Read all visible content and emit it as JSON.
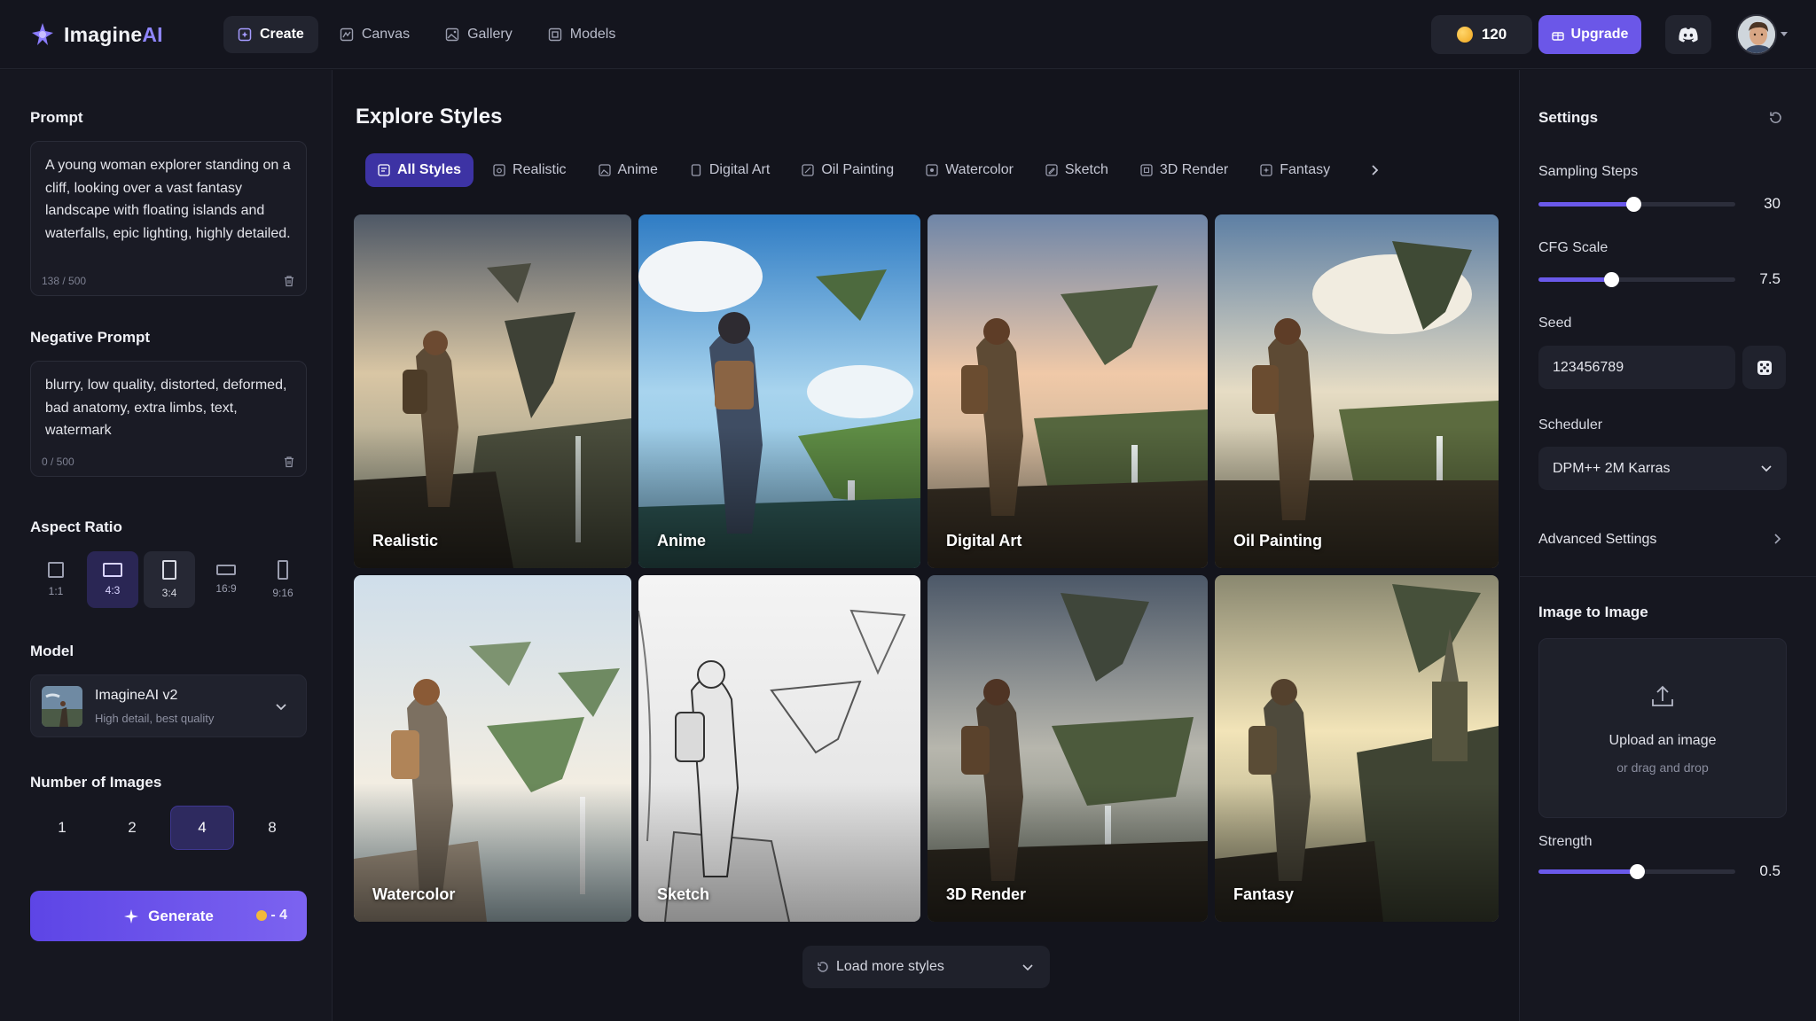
{
  "app": {
    "name_main": "Imagine",
    "name_accent": "AI",
    "brand_color": "#6b57e8"
  },
  "nav": {
    "items": [
      {
        "label": "Create",
        "icon": "sparkle-square-icon"
      },
      {
        "label": "Canvas",
        "icon": "canvas-icon"
      },
      {
        "label": "Gallery",
        "icon": "image-icon"
      },
      {
        "label": "Models",
        "icon": "cube-icon"
      }
    ]
  },
  "header": {
    "credits": "120",
    "upgrade_label": "Upgrade"
  },
  "left": {
    "prompt_label": "Prompt",
    "prompt_text": "A young woman explorer standing on a cliff, looking over a vast fantasy landscape with floating islands and waterfalls, epic lighting, highly detailed.",
    "prompt_counter": "138 / 500",
    "negative_label": "Negative Prompt",
    "negative_text": "blurry, low quality, distorted, deformed, bad anatomy, extra limbs, text, watermark",
    "negative_counter": "0 / 500",
    "aspect_label": "Aspect Ratio",
    "aspects": [
      "1:1",
      "4:3",
      "3:4",
      "16:9",
      "9:16"
    ],
    "model_label": "Model",
    "model_name": "ImagineAI v2",
    "model_sub": "High detail, best quality",
    "num_label": "Number of Images",
    "nums": [
      "1",
      "2",
      "4",
      "8"
    ],
    "generate_label": "Generate",
    "generate_cost": "- 4"
  },
  "main": {
    "title": "Explore Styles",
    "tabs": [
      "All Styles",
      "Realistic",
      "Anime",
      "Digital Art",
      "Oil Painting",
      "Watercolor",
      "Sketch",
      "3D Render",
      "Fantasy"
    ],
    "cards": [
      "Realistic",
      "Anime",
      "Digital Art",
      "Oil Painting",
      "Watercolor",
      "Sketch",
      "3D Render",
      "Fantasy"
    ],
    "load_more": "Load more styles"
  },
  "right": {
    "settings_title": "Settings",
    "sampling_label": "Sampling Steps",
    "sampling_value": "30",
    "sampling_fraction": 0.48,
    "cfg_label": "CFG Scale",
    "cfg_value": "7.5",
    "cfg_fraction": 0.37,
    "seed_label": "Seed",
    "seed_value": "123456789",
    "scheduler_label": "Scheduler",
    "scheduler_value": "DPM++ 2M Karras",
    "advanced_label": "Advanced Settings",
    "img2img_title": "Image to Image",
    "upload_main": "Upload an image",
    "upload_sub": "or drag and drop",
    "strength_label": "Strength",
    "strength_value": "0.5",
    "strength_fraction": 0.5
  }
}
